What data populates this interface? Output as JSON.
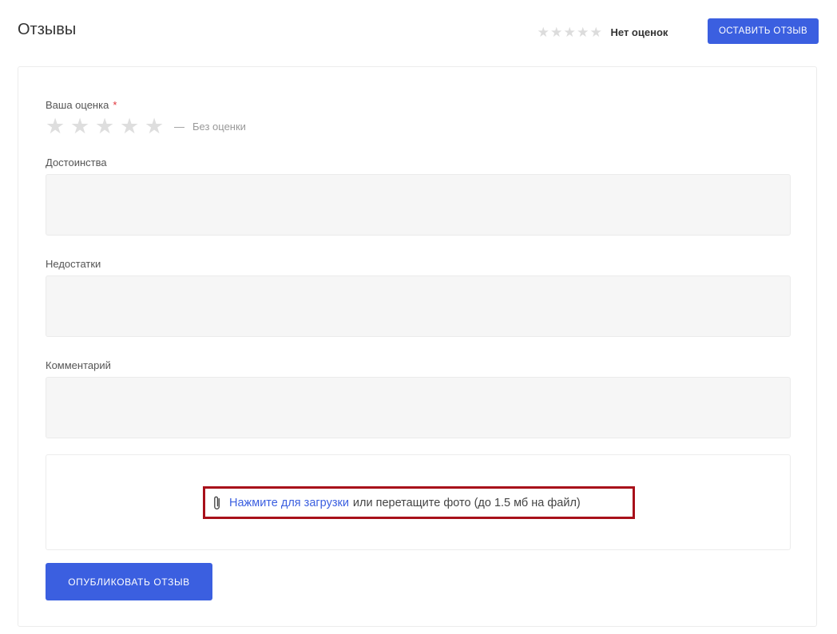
{
  "header": {
    "title": "Отзывы",
    "summary_stars": 0,
    "summary_text": "Нет оценок",
    "leave_review_label": "ОСТАВИТЬ ОТЗЫВ"
  },
  "form": {
    "rating": {
      "label": "Ваша оценка",
      "required_mark": "*",
      "value": 0,
      "max": 5,
      "dash": "—",
      "status_text": "Без оценки"
    },
    "fields": [
      {
        "label": "Достоинства",
        "value": ""
      },
      {
        "label": "Недостатки",
        "value": ""
      },
      {
        "label": "Комментарий",
        "value": ""
      }
    ],
    "upload": {
      "link_text": "Нажмите для загрузки",
      "rest_text": "или перетащите фото (до 1.5 мб на файл)",
      "icon": "paperclip-icon"
    },
    "publish_label": "ОПУБЛИКОВАТЬ ОТЗЫВ"
  },
  "colors": {
    "accent": "#3b5fe0",
    "star_empty": "#dedede",
    "required": "#e0353b",
    "highlight_border": "#a8101a"
  }
}
